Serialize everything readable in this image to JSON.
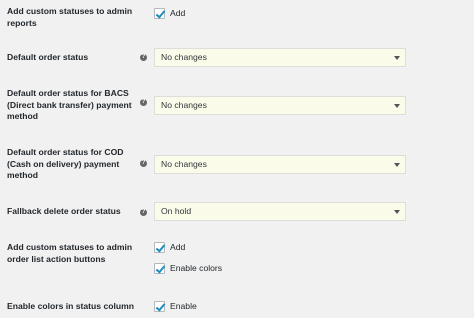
{
  "settings": {
    "admin_reports": {
      "label": "Add custom statuses to admin reports",
      "checkbox_label": "Add",
      "checked": true
    },
    "default_order_status": {
      "label": "Default order status",
      "help_icon": "question-circle-icon",
      "value": "No changes"
    },
    "default_status_bacs": {
      "label": "Default order status for BACS (Direct bank transfer) payment method",
      "help_icon": "question-circle-icon",
      "value": "No changes"
    },
    "default_status_cod": {
      "label": "Default order status for COD (Cash on delivery) payment method",
      "help_icon": "question-circle-icon",
      "value": "No changes"
    },
    "fallback_delete": {
      "label": "Fallback delete order status",
      "help_icon": "question-circle-icon",
      "value": "On hold"
    },
    "order_list_actions": {
      "label": "Add custom statuses to admin order list action buttons",
      "add_label": "Add",
      "add_checked": true,
      "colors_label": "Enable colors",
      "colors_checked": true
    },
    "status_column_colors": {
      "label": "Enable colors in status column",
      "checkbox_label": "Enable",
      "checked": true
    }
  },
  "colors": {
    "select_background": "#fbfbe9",
    "checkmark": "#1e8cbe",
    "page_background": "#f1f1f1"
  }
}
